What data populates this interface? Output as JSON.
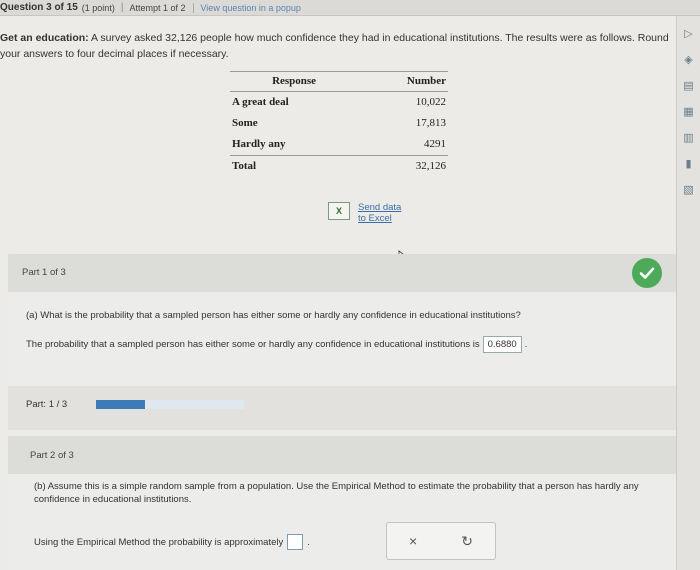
{
  "topbar": {
    "question": "Question 3 of 15",
    "points": "(1 point)",
    "attempt": "Attempt 1 of 2",
    "view_popup": "View question in a popup"
  },
  "intro": {
    "title": "Get an education:",
    "text": " A survey asked 32,126 people how much confidence they had in educational institutions. The results were as follows. Round your answers to four decimal places if necessary."
  },
  "table": {
    "headers": [
      "Response",
      "Number"
    ],
    "rows": [
      {
        "response": "A great deal",
        "number": "10,022"
      },
      {
        "response": "Some",
        "number": "17,813"
      },
      {
        "response": "Hardly any",
        "number": "4291"
      }
    ],
    "total": {
      "response": "Total",
      "number": "32,126"
    }
  },
  "excel": {
    "line1": "Send data",
    "line2": "to Excel"
  },
  "part1": {
    "label": "Part 1 of 3",
    "question": "(a) What is the probability that a sampled person has either some or hardly any confidence in educational institutions?",
    "answer_prefix": "The probability that a sampled person has either some or hardly any confidence in educational institutions is",
    "answer_value": "0.6880",
    "answer_suffix": "."
  },
  "progress": {
    "label": "Part: 1 / 3",
    "fraction": 0.33
  },
  "part2": {
    "label": "Part 2 of 3",
    "question": "(b) Assume this is a simple random sample from a population. Use the Empirical Method to estimate the probability that a person has hardly any confidence in educational institutions.",
    "answer_prefix": "Using the Empirical Method the probability is approximately",
    "answer_suffix": "."
  },
  "actions": {
    "clear_glyph": "×",
    "undo_glyph": "↻"
  },
  "colors": {
    "check": "#4caa58",
    "progress": "#3d7ab8",
    "link": "#3b6ea8"
  }
}
